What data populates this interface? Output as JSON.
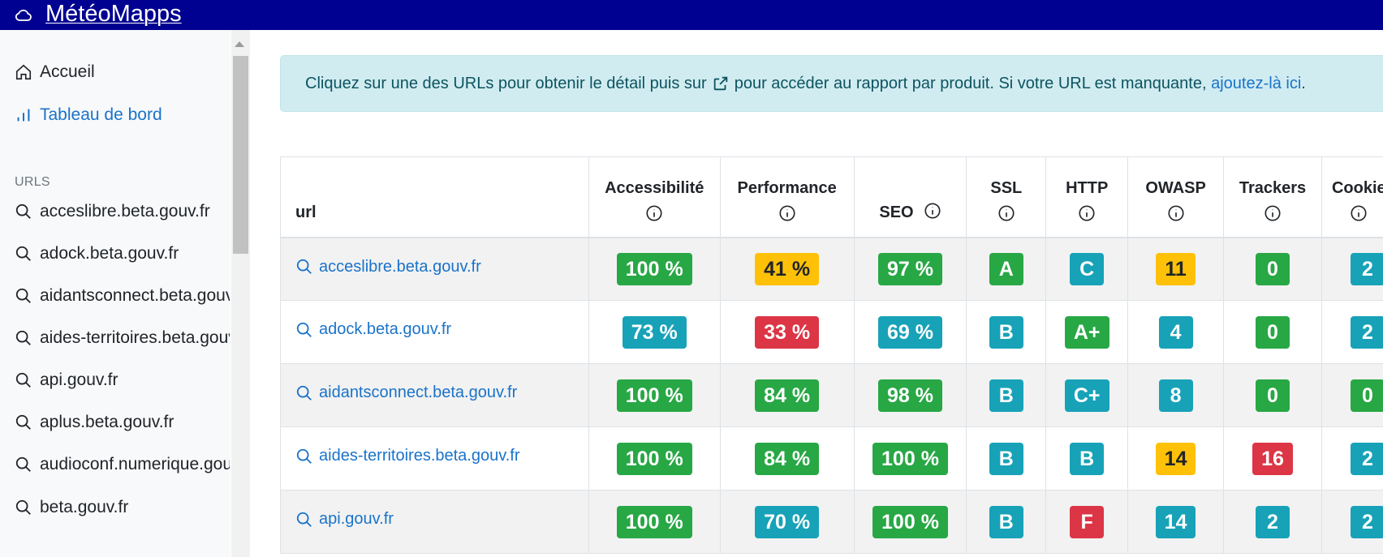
{
  "header": {
    "brand": "MétéoMapps",
    "logo_icon": "cloud-icon"
  },
  "sidebar": {
    "home_label": "Accueil",
    "dashboard_label": "Tableau de bord",
    "urls_title": "URLS",
    "url_items": [
      "acceslibre.beta.gouv.fr",
      "adock.beta.gouv.fr",
      "aidantsconnect.beta.gouv.fr",
      "aides-territoires.beta.gouv.fr",
      "api.gouv.fr",
      "aplus.beta.gouv.fr",
      "audioconf.numerique.gouv.fr",
      "beta.gouv.fr"
    ]
  },
  "alert": {
    "text_before": "Cliquez sur une des URLs pour obtenir le détail puis sur",
    "text_after": "pour accéder au rapport par produit. Si votre URL est manquante,",
    "link_text": "ajoutez-là ici",
    "end": "."
  },
  "table": {
    "headers": {
      "url": "url",
      "accessibilite": "Accessibilité",
      "performance": "Performance",
      "seo": "SEO",
      "ssl": "SSL",
      "http": "HTTP",
      "owasp": "OWASP",
      "trackers": "Trackers",
      "cookies": "Cookies"
    },
    "rows": [
      {
        "url": "acceslibre.beta.gouv.fr",
        "accessibilite": "100 %",
        "performance": "41 %",
        "seo": "97 %",
        "ssl": "A",
        "http": "C",
        "owasp": "11",
        "trackers": "0",
        "cookies": "2"
      },
      {
        "url": "adock.beta.gouv.fr",
        "accessibilite": "73 %",
        "performance": "33 %",
        "seo": "69 %",
        "ssl": "B",
        "http": "A+",
        "owasp": "4",
        "trackers": "0",
        "cookies": "2"
      },
      {
        "url": "aidantsconnect.beta.gouv.fr",
        "accessibilite": "100 %",
        "performance": "84 %",
        "seo": "98 %",
        "ssl": "B",
        "http": "C+",
        "owasp": "8",
        "trackers": "0",
        "cookies": "0"
      },
      {
        "url": "aides-territoires.beta.gouv.fr",
        "accessibilite": "100 %",
        "performance": "84 %",
        "seo": "100 %",
        "ssl": "B",
        "http": "B",
        "owasp": "14",
        "trackers": "16",
        "cookies": "2"
      },
      {
        "url": "api.gouv.fr",
        "accessibilite": "100 %",
        "performance": "70 %",
        "seo": "100 %",
        "ssl": "B",
        "http": "F",
        "owasp": "14",
        "trackers": "2",
        "cookies": "2"
      }
    ]
  },
  "badge_colors": {
    "success": "#28a745",
    "info": "#17a2b8",
    "warning": "#ffc107",
    "danger": "#dc3545"
  }
}
